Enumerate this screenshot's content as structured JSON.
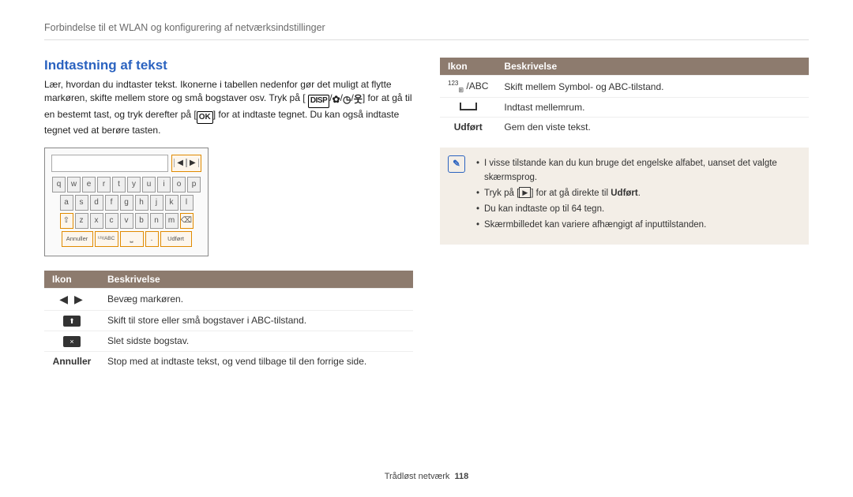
{
  "breadcrumb": "Forbindelse til et WLAN og konfigurering af netværksindstillinger",
  "section_title": "Indtastning af tekst",
  "intro_parts": {
    "p1a": "Lær, hvordan du indtaster tekst. Ikonerne i tabellen nedenfor gør det muligt at flytte markøren, skifte mellem store og små bogstaver osv. Tryk på [",
    "disp": "DISP",
    "p1b": "/",
    "p1c": "/",
    "p1d": "/",
    "p1e": "] for at gå til en bestemt tast, og tryk derefter på [",
    "ok": "OK",
    "p1f": "] for at indtaste tegnet. Du kan også indtaste tegnet ved at berøre tasten."
  },
  "keyboard": {
    "row1": [
      "q",
      "w",
      "e",
      "r",
      "t",
      "y",
      "u",
      "i",
      "o",
      "p"
    ],
    "row2": [
      "a",
      "s",
      "d",
      "f",
      "g",
      "h",
      "j",
      "k",
      "l"
    ],
    "row3": [
      "⇧",
      "z",
      "x",
      "c",
      "v",
      "b",
      "n",
      "m",
      "⌫"
    ],
    "bottom_left": "Annuller",
    "bottom_mode": "¹²³/ABC",
    "bottom_space": "␣",
    "bottom_dot": ".",
    "bottom_right": "Udført"
  },
  "table_header": {
    "icon": "Ikon",
    "desc": "Beskrivelse"
  },
  "left_table": [
    {
      "icon_type": "arrows",
      "desc": "Bevæg markøren."
    },
    {
      "icon_type": "shift",
      "desc": "Skift til store eller små bogstaver i ABC-tilstand."
    },
    {
      "icon_type": "backspace",
      "desc": "Slet sidste bogstav."
    },
    {
      "icon_type": "label",
      "icon_label": "Annuller",
      "desc": "Stop med at indtaste tekst, og vend tilbage til den forrige side."
    }
  ],
  "right_table": [
    {
      "icon_type": "symabc",
      "desc": "Skift mellem Symbol- og ABC-tilstand."
    },
    {
      "icon_type": "space",
      "desc": "Indtast mellemrum."
    },
    {
      "icon_type": "label",
      "icon_label": "Udført",
      "desc": "Gem den viste tekst."
    }
  ],
  "note": {
    "l1": "I visse tilstande kan du kun bruge det engelske alfabet, uanset det valgte skærmsprog.",
    "l2a": "Tryk på [",
    "l2b": "] for at gå direkte til ",
    "l2c": "Udført",
    "l2d": ".",
    "l3": "Du kan indtaste op til 64 tegn.",
    "l4": "Skærmbilledet kan variere afhængigt af inputtilstanden."
  },
  "footer_label": "Trådløst netværk",
  "footer_page": "118"
}
